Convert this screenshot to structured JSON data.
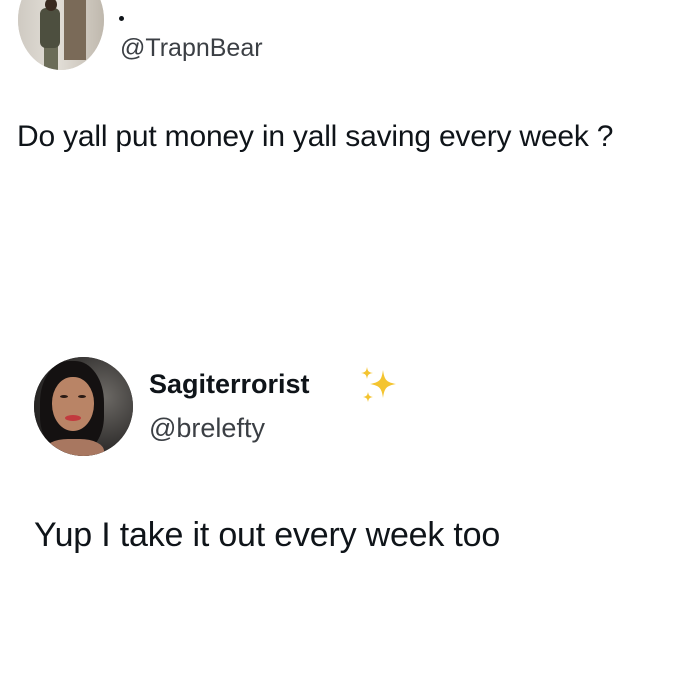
{
  "original_tweet": {
    "handle": "@TrapnBear",
    "text": "Do yall put money in yall saving every week ?"
  },
  "reply_tweet": {
    "display_name": "Sagiterrorist",
    "name_emoji_icon": "sparkles-icon",
    "handle": "@brelefty",
    "text": "Yup I take it out every week too"
  },
  "colors": {
    "background": "#ffffff",
    "text": "#0f1419",
    "handle_text": "#3b3f44",
    "sparkle": "#f4c430"
  }
}
